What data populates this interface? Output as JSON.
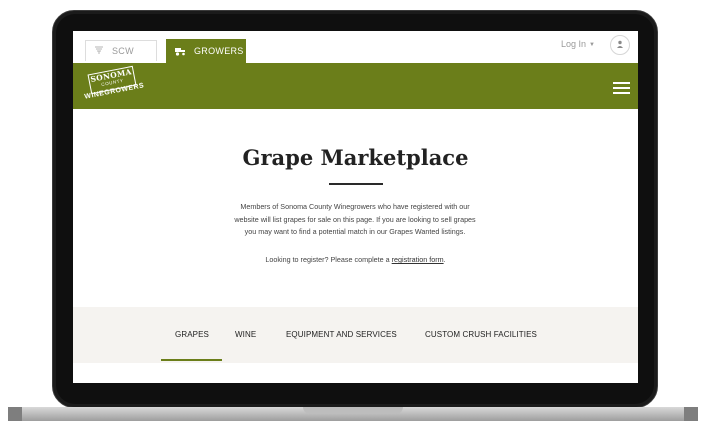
{
  "colors": {
    "brand_green": "#6b7e1a",
    "band_bg": "#f5f3f0",
    "title_text": "#222222"
  },
  "topbar": {
    "scw_tab": {
      "label": "SCW",
      "icon": "grape-icon"
    },
    "growers_tab": {
      "label": "GROWERS",
      "icon": "tractor-icon"
    },
    "login": {
      "label": "Log In",
      "icon": "chevron-down-icon"
    },
    "user_icon": "user-icon"
  },
  "header": {
    "logo": {
      "line1": "SONOMA",
      "line2": "COUNTY",
      "line3": "WINEGROWERS"
    },
    "menu_icon": "hamburger-menu-icon"
  },
  "main": {
    "title": "Grape Marketplace",
    "intro_lines": [
      "Members of Sonoma County Winegrowers who have registered with our",
      "website will list grapes for sale on this page. If you are looking to sell grapes",
      "you may want to find a potential match in our Grapes Wanted listings."
    ],
    "register_text": "Looking to register? Please complete a ",
    "register_link": "registration form",
    "register_end": "."
  },
  "categories": {
    "active": "GRAPES",
    "items": [
      "GRAPES",
      "WINE",
      "EQUIPMENT AND SERVICES",
      "CUSTOM CRUSH FACILITIES"
    ]
  }
}
